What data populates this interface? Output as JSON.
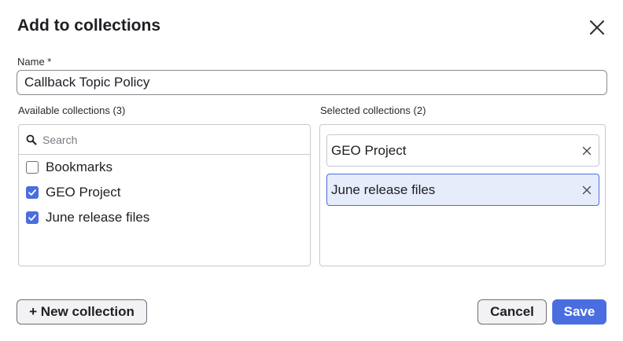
{
  "dialog": {
    "title": "Add to collections",
    "close_icon": "close-icon"
  },
  "name_field": {
    "label": "Name *",
    "value": "Callback Topic Policy"
  },
  "available": {
    "label": "Available collections (3)",
    "search_placeholder": "Search",
    "search_icon": "search-icon",
    "items": [
      {
        "label": "Bookmarks",
        "checked": false
      },
      {
        "label": "GEO Project",
        "checked": true
      },
      {
        "label": "June release files",
        "checked": true
      }
    ]
  },
  "selected": {
    "label": "Selected collections (2)",
    "items": [
      {
        "label": "GEO Project",
        "active": false,
        "remove_icon": "close-icon"
      },
      {
        "label": "June release files",
        "active": true,
        "remove_icon": "close-icon"
      }
    ]
  },
  "footer": {
    "new_collection_label": "+ New collection",
    "cancel_label": "Cancel",
    "save_label": "Save"
  },
  "colors": {
    "accent": "#4a6ee0",
    "selected_bg": "#e7ecfb",
    "border": "#c8c8ce"
  }
}
